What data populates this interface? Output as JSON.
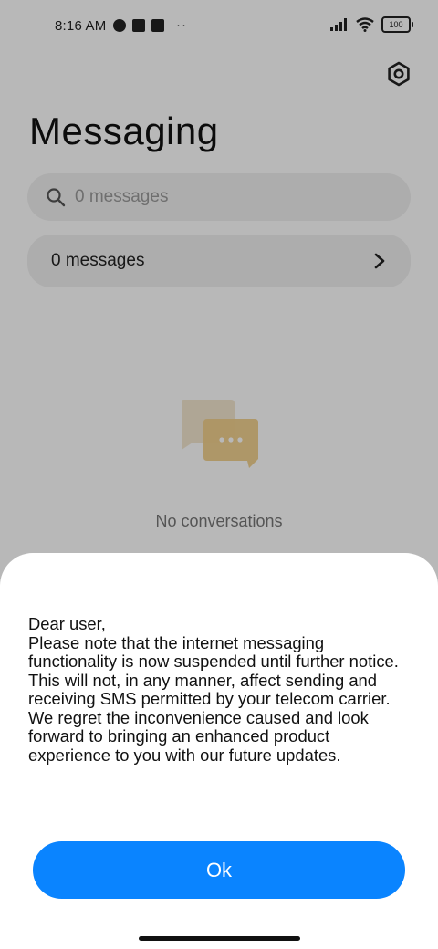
{
  "status_bar": {
    "time": "8:16 AM",
    "battery": "100",
    "more_indicator": "··"
  },
  "header": {
    "title": "Messaging"
  },
  "search": {
    "placeholder": "0 messages"
  },
  "list": {
    "row_label": "0 messages"
  },
  "empty_state": {
    "text": "No conversations"
  },
  "dialog": {
    "greeting": "Dear user,",
    "body": "Please note that the internet messaging functionality is now suspended until further notice. This will not, in any manner, affect sending and receiving SMS permitted by your telecom carrier. We regret the inconvenience caused and look forward to bringing an enhanced product experience to you with our future updates.",
    "ok_label": "Ok"
  },
  "colors": {
    "primary": "#0a84ff",
    "scrim": "#000000",
    "empty_art_back": "#f3e7cf",
    "empty_art_front": "#f0cf8a"
  },
  "icons": {
    "settings": "gear-icon",
    "search": "search-icon",
    "chevron": "chevron-right-icon",
    "empty_art": "chat-bubbles-icon"
  }
}
